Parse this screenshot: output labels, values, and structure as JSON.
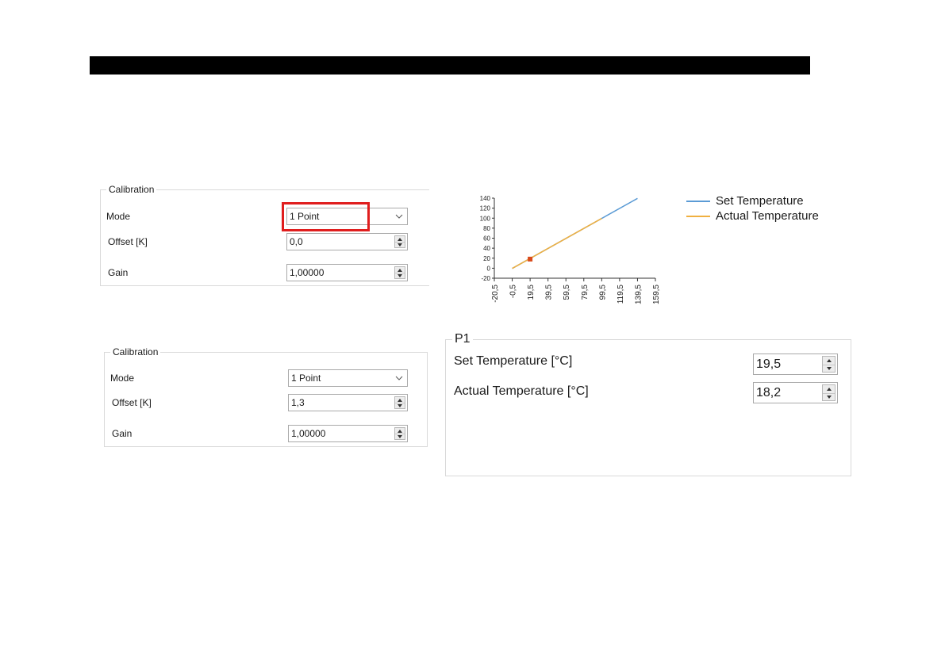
{
  "calib1": {
    "title": "Calibration",
    "mode_label": "Mode",
    "mode_value": "1 Point",
    "offset_label": "Offset [K]",
    "offset_value": "0,0",
    "gain_label": "Gain",
    "gain_value": "1,00000"
  },
  "calib2": {
    "title": "Calibration",
    "mode_label": "Mode",
    "mode_value": "1 Point",
    "offset_label": "Offset [K]",
    "offset_value": "1,3",
    "gain_label": "Gain",
    "gain_value": "1,00000"
  },
  "p1": {
    "title": "P1",
    "set_label": "Set Temperature [°C]",
    "set_value": "19,5",
    "actual_label": "Actual Temperature [°C]",
    "actual_value": "18,2"
  },
  "colors": {
    "highlight": "#e01e1e",
    "set_series": "#5b9bd5",
    "actual_series": "#f0b040",
    "point_marker": "#d94a1a"
  },
  "chart_data": {
    "type": "line",
    "x_tick_labels": [
      "-20,5",
      "-0,5",
      "19,5",
      "39,5",
      "59,5",
      "79,5",
      "99,5",
      "119,5",
      "139,5",
      "159,5"
    ],
    "x_ticks": [
      -20.5,
      -0.5,
      19.5,
      39.5,
      59.5,
      79.5,
      99.5,
      119.5,
      139.5,
      159.5
    ],
    "y_ticks": [
      -20,
      0,
      20,
      40,
      60,
      80,
      100,
      120,
      140
    ],
    "xlim": [
      -20.5,
      159.5
    ],
    "ylim": [
      -20,
      140
    ],
    "series": [
      {
        "name": "Set Temperature",
        "color": "#5b9bd5",
        "x": [
          -0.5,
          139.5
        ],
        "y": [
          -0.5,
          139.5
        ]
      },
      {
        "name": "Actual Temperature",
        "color": "#f0b040",
        "x": [
          -0.5,
          99.5
        ],
        "y": [
          -0.5,
          99.5
        ]
      }
    ],
    "points": [
      {
        "x": 19.5,
        "y": 18.2,
        "color": "#d94a1a"
      }
    ],
    "legend_position": "right"
  }
}
